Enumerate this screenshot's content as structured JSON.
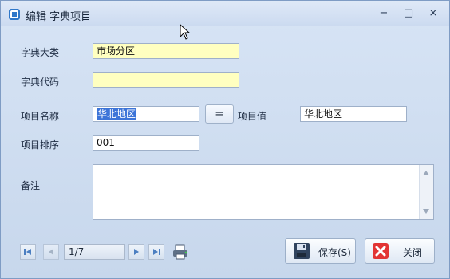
{
  "window": {
    "title": "编辑 字典项目",
    "minimize_icon": "minimize-icon",
    "restore_icon": "restore-icon",
    "close_icon": "close-icon"
  },
  "form": {
    "dict_category": {
      "label": "字典大类",
      "value": "市场分区"
    },
    "dict_code": {
      "label": "字典代码",
      "value": ""
    },
    "item_name": {
      "label": "项目名称",
      "value": "华北地区"
    },
    "equals_button": "=",
    "item_value": {
      "label": "项目值",
      "value": "华北地区"
    },
    "item_order": {
      "label": "项目排序",
      "value": "001"
    },
    "remarks": {
      "label": "备注",
      "value": ""
    }
  },
  "navigator": {
    "position": "1/7"
  },
  "buttons": {
    "save": "保存(S)",
    "close": "关闭"
  },
  "colors": {
    "accent": "#3c74d8",
    "yellow_field": "#ffffc0",
    "window_bg": "#c9d9ee"
  }
}
